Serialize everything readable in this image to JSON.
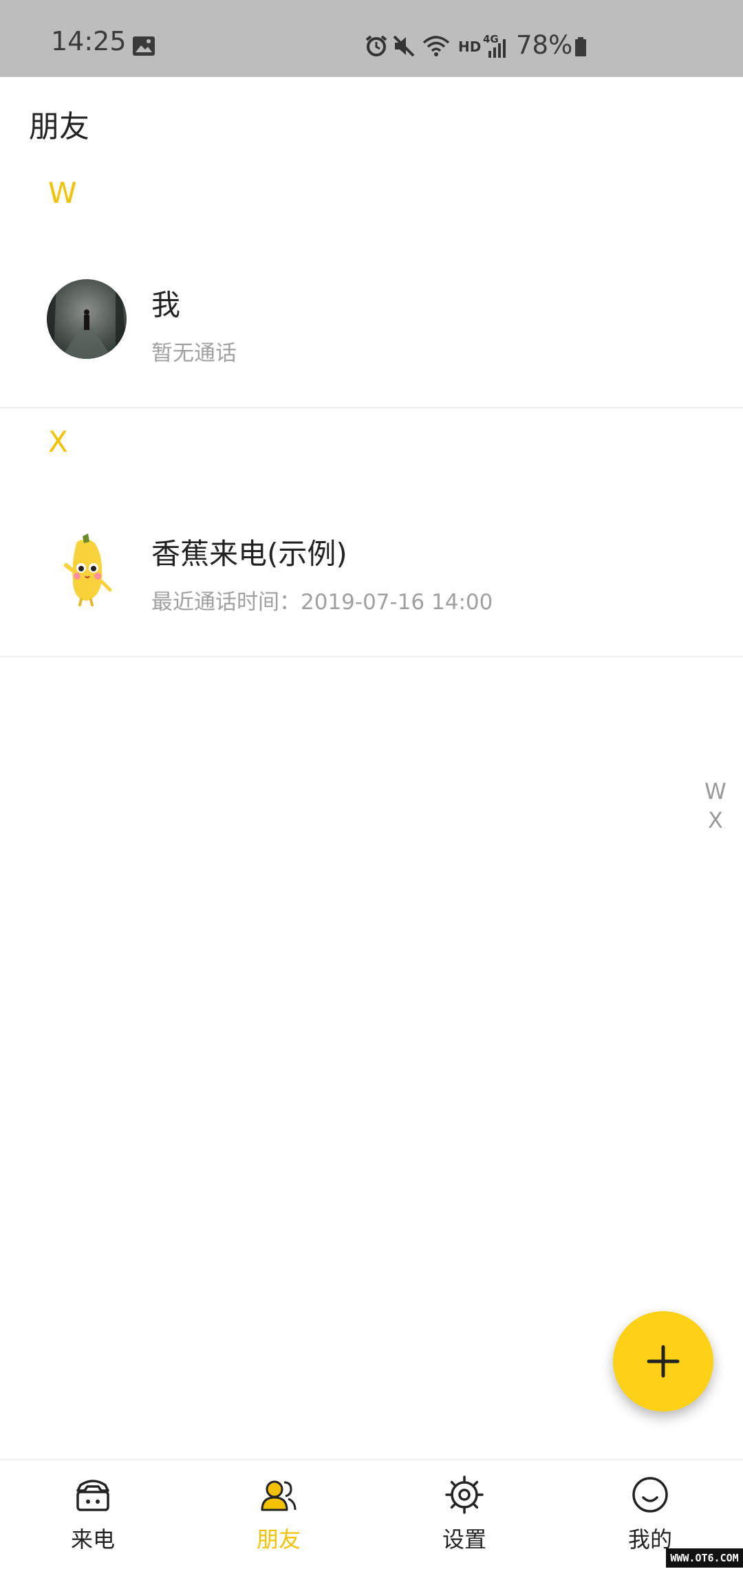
{
  "status_bar": {
    "time": "14:25",
    "network_label": "HD",
    "network_type": "4G",
    "battery_percent": "78%",
    "icons": [
      "gallery-icon",
      "alarm-icon",
      "mute-icon",
      "wifi-icon",
      "signal-icon",
      "battery-icon"
    ]
  },
  "page": {
    "title": "朋友"
  },
  "sections": [
    {
      "letter": "W",
      "contacts": [
        {
          "name": "我",
          "subtitle": "暂无通话",
          "avatar": "dark-forest-photo"
        }
      ]
    },
    {
      "letter": "X",
      "contacts": [
        {
          "name": "香蕉来电(示例)",
          "subtitle": "最近通话时间：2019-07-16 14:00",
          "avatar": "banana-mascot"
        }
      ]
    }
  ],
  "index_bar": [
    "W",
    "X"
  ],
  "fab": {
    "icon": "plus-icon"
  },
  "bottom_nav": [
    {
      "label": "来电",
      "icon": "phone-icon",
      "active": false
    },
    {
      "label": "朋友",
      "icon": "friends-icon",
      "active": true
    },
    {
      "label": "设置",
      "icon": "settings-icon",
      "active": false
    },
    {
      "label": "我的",
      "icon": "smile-icon",
      "active": false
    }
  ],
  "watermark": "WWW.OT6.COM",
  "colors": {
    "accent": "#f2c200",
    "fab": "#fdd116",
    "status_bar": "#bdbdbd"
  }
}
